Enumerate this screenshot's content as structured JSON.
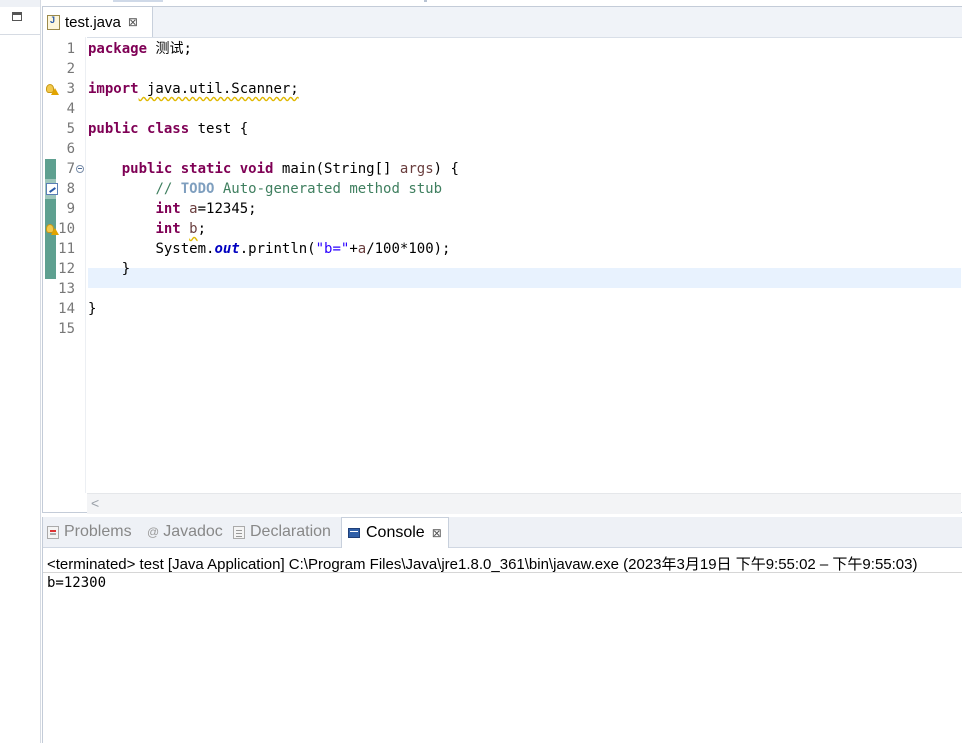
{
  "editor": {
    "tab_title": "test.java",
    "tab_close": "⊠",
    "line_numbers": [
      "1",
      "2",
      "3",
      "4",
      "5",
      "6",
      "7",
      "8",
      "9",
      "10",
      "11",
      "12",
      "13",
      "14",
      "15"
    ],
    "code": {
      "l1_kw": "package",
      "l1_rest": " 测试;",
      "l3_kw": "import",
      "l3_rest": " java.util.Scanner;",
      "l5_kw1": "public",
      "l5_kw2": "class",
      "l5_rest": " test {",
      "l7_kw1": "public",
      "l7_kw2": "static",
      "l7_kw3": "void",
      "l7_mid": " main(String[] ",
      "l7_var": "args",
      "l7_end": ") {",
      "l8_comment_start": "// ",
      "l8_todo": "TODO",
      "l8_comment_rest": " Auto-generated method stub",
      "l9_kw": "int",
      "l9_var": "a",
      "l9_rest": "=12345;",
      "l10_kw": "int",
      "l10_var": "b",
      "l10_rest": ";",
      "l11_pre": "System.",
      "l11_field": "out",
      "l11_mid": ".println(",
      "l11_str": "\"b=\"",
      "l11_op": "+",
      "l11_var": "a",
      "l11_end": "/100*100);",
      "l12": "}",
      "l14": "}"
    },
    "scroll_left": "<"
  },
  "panel": {
    "tabs": {
      "problems": "Problems",
      "javadoc_icon": "@",
      "javadoc": "Javadoc",
      "declaration": "Declaration",
      "console": "Console",
      "console_close": "⊠"
    },
    "terminated_text": "<terminated> test [Java Application] C:\\Program Files\\Java\\jre1.8.0_361\\bin\\javaw.exe  (2023年3月19日 下午9:55:02 – 下午9:55:03)",
    "output": "b=12300"
  },
  "icons": {
    "minimize": "minimize-icon",
    "java_file": "java-file-icon",
    "warning": "warning-bulb-icon",
    "task": "task-icon",
    "fold": "fold-collapse-icon",
    "console": "console-icon"
  },
  "colors": {
    "keyword": "#7f0055",
    "comment": "#3f7f5f",
    "string": "#2a00ff",
    "field": "#0000c0",
    "local_var": "#6a3e3e",
    "current_line": "#e8f2fe",
    "change_ruler": "#5ea090"
  }
}
